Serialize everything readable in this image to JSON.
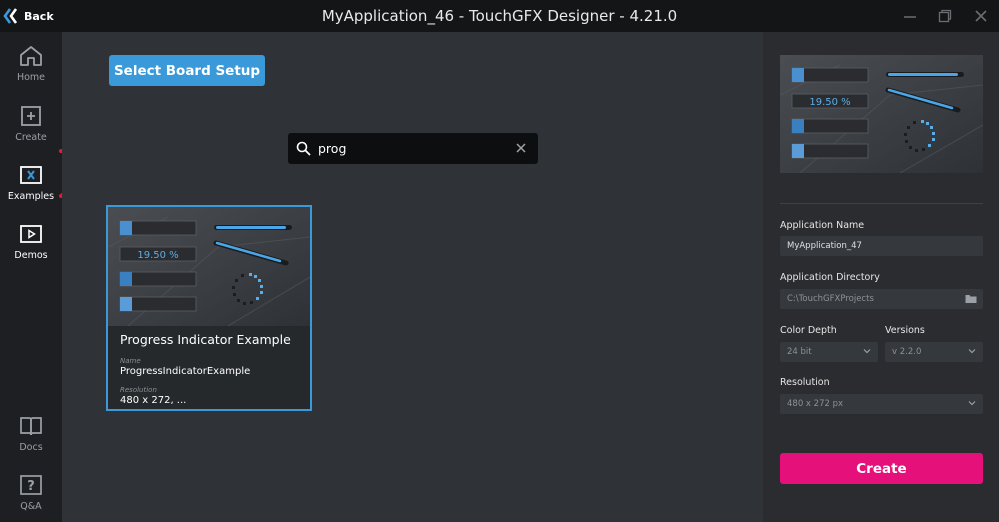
{
  "titlebar": {
    "back_label": "Back",
    "title": "MyApplication_46 - TouchGFX Designer - 4.21.0",
    "minimize_icon": "minimize-icon",
    "maximize_icon": "maximize-icon",
    "close_icon": "close-icon"
  },
  "sidebar": {
    "items": [
      {
        "label": "Home",
        "icon": "home-icon"
      },
      {
        "label": "Create",
        "icon": "create-icon"
      },
      {
        "label": "Examples",
        "icon": "examples-icon",
        "active": true
      },
      {
        "label": "Demos",
        "icon": "demos-icon"
      },
      {
        "label": "Docs",
        "icon": "docs-icon"
      },
      {
        "label": "Q&A",
        "icon": "qa-icon"
      }
    ]
  },
  "main": {
    "board_button_label": "Select Board Setup",
    "search": {
      "value": "prog",
      "icon": "search-icon",
      "clear_icon": "clear-icon"
    },
    "card": {
      "title": "Progress Indicator Example",
      "name_label": "Name",
      "name_value": "ProgressIndicatorExample",
      "resolution_label": "Resolution",
      "resolution_value": "480 x 272, ...",
      "thumbnail": {
        "percent_text": "19.50 %"
      }
    }
  },
  "right_panel": {
    "preview": {
      "percent_text": "19.50 %"
    },
    "app_name_label": "Application Name",
    "app_name_value": "MyApplication_47",
    "app_dir_label": "Application Directory",
    "app_dir_placeholder": "C:\\TouchGFXProjects",
    "color_depth_label": "Color Depth",
    "color_depth_value": "24 bit",
    "versions_label": "Versions",
    "versions_value": "v 2.2.0",
    "resolution_label": "Resolution",
    "resolution_value": "480 x 272 px",
    "create_label": "Create"
  },
  "colors": {
    "accent_blue": "#3a9ad9",
    "create_pink": "#e6107a",
    "annotation_red": "#e8192c"
  }
}
